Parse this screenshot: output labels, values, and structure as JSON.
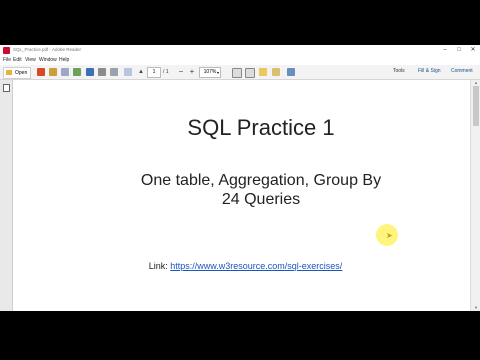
{
  "window": {
    "title": "SQL_Practice.pdf - Adobe Reader",
    "controls": [
      "minimize-icon",
      "maximize-icon",
      "close-icon"
    ]
  },
  "menu": [
    "File",
    "Edit",
    "View",
    "Window",
    "Help"
  ],
  "toolbar": {
    "open_label": "Open",
    "page_current": "1",
    "page_total": "/ 1",
    "zoom": "107%",
    "tools_label": "Tools",
    "fill_sign_label": "Fill & Sign",
    "comment_label": "Comment"
  },
  "document": {
    "title": "SQL Practice 1",
    "subtitle_line1": "One table, Aggregation, Group By",
    "subtitle_line2": "24 Queries",
    "link_label": "Link:",
    "link_url": "https://www.w3resource.com/sql-exercises/"
  },
  "colors": {
    "accent": "#c8102e",
    "link": "#1a55c0",
    "cursor_highlight": "#fff050"
  }
}
